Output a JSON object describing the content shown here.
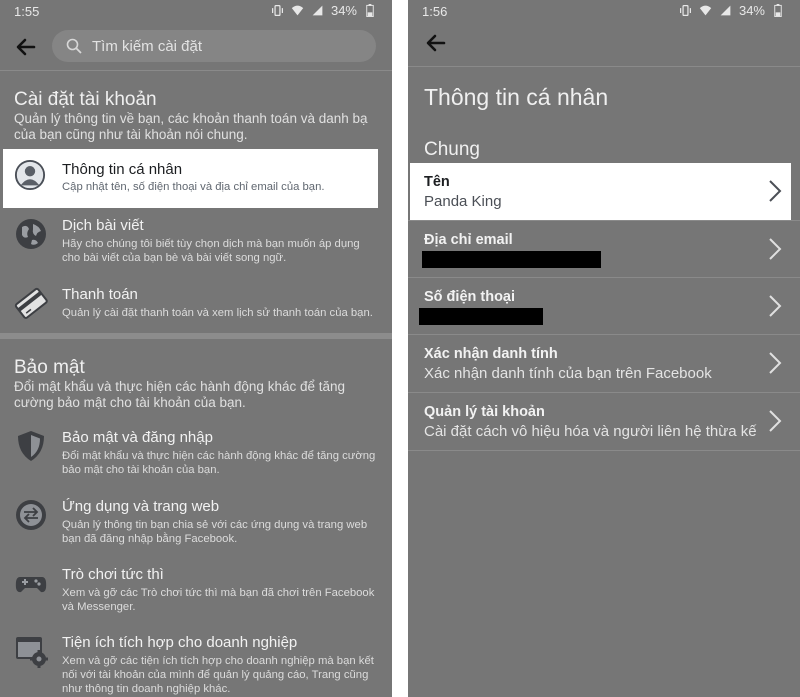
{
  "left": {
    "status": {
      "time": "1:55",
      "battery": "34%"
    },
    "search": {
      "placeholder": "Tìm kiếm cài đặt"
    },
    "account_section": {
      "title": "Cài đặt tài khoản",
      "description": "Quản lý thông tin về bạn, các khoản thanh toán và danh bạ của bạn cũng như tài khoản nói chung.",
      "items": [
        {
          "title": "Thông tin cá nhân",
          "desc": "Cập nhật tên, số điện thoại và địa chỉ email của bạn.",
          "icon": "person-icon"
        },
        {
          "title": "Dịch bài viết",
          "desc": "Hãy cho chúng tôi biết tùy chọn dịch mà bạn muốn áp dụng cho bài viết của bạn bè và bài viết song ngữ.",
          "icon": "globe-icon"
        },
        {
          "title": "Thanh toán",
          "desc": "Quản lý cài đặt thanh toán và xem lịch sử thanh toán của bạn.",
          "icon": "credit-card-icon"
        }
      ]
    },
    "security_section": {
      "title": "Bảo mật",
      "description": "Đổi mật khẩu và thực hiện các hành động khác để tăng cường bảo mật cho tài khoản của bạn.",
      "items": [
        {
          "title": "Bảo mật và đăng nhập",
          "desc": "Đổi mật khẩu và thực hiện các hành động khác để tăng cường bảo mật cho tài khoản của bạn.",
          "icon": "shield-icon"
        },
        {
          "title": "Ứng dụng và trang web",
          "desc": "Quản lý thông tin bạn chia sẻ với các ứng dụng và trang web bạn đã đăng nhập bằng Facebook.",
          "icon": "swap-arrows-icon"
        },
        {
          "title": "Trò chơi tức thì",
          "desc": "Xem và gỡ các Trò chơi tức thì mà bạn đã chơi trên Facebook và Messenger.",
          "icon": "gamepad-icon"
        },
        {
          "title": "Tiện ích tích hợp cho doanh nghiệp",
          "desc": "Xem và gỡ các tiện ích tích hợp cho doanh nghiệp mà bạn kết nối với tài khoản của mình để quản lý quảng cáo, Trang cũng như thông tin doanh nghiệp khác.",
          "icon": "business-settings-icon"
        }
      ]
    }
  },
  "right": {
    "status": {
      "time": "1:56",
      "battery": "34%"
    },
    "page_title": "Thông tin cá nhân",
    "group_title": "Chung",
    "rows": [
      {
        "label": "Tên",
        "value": "Panda King"
      },
      {
        "label": "Địa chỉ email",
        "value": ""
      },
      {
        "label": "Số điện thoại",
        "value": ""
      },
      {
        "label": "Xác nhận danh tính",
        "value": "Xác nhận danh tính của bạn trên Facebook"
      },
      {
        "label": "Quản lý tài khoản",
        "value": "Cài đặt cách vô hiệu hóa và người liên hệ thừa kế"
      }
    ]
  },
  "colors": {
    "overlay": "#767676",
    "highlight": "#ffffff",
    "text_dark": "#1c1e21"
  }
}
